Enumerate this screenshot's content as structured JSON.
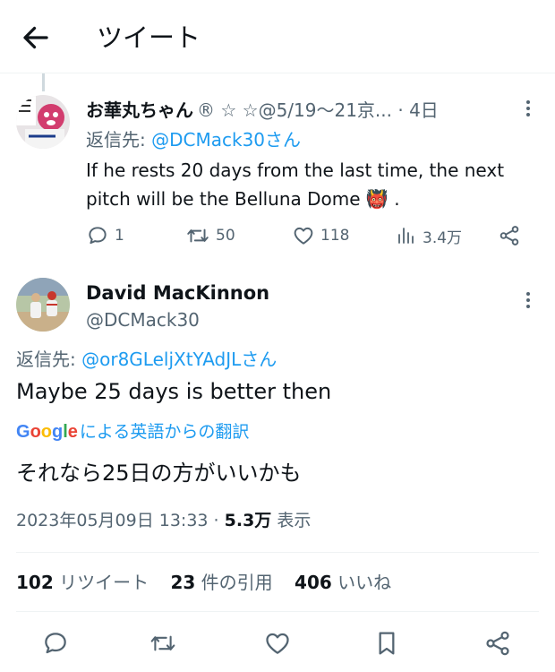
{
  "header": {
    "title": "ツイート"
  },
  "reply_tweet": {
    "display_name": "お華丸ちゃん",
    "name_suffix": "® ☆ ☆@5/19〜21京... · 4日",
    "reply_to_prefix": "返信先: ",
    "reply_to_mention": "@DCMack30さん",
    "text": "If he rests 20 days from the last time, the next pitch will be the Belluna Dome 👹 .",
    "stats": {
      "replies": "1",
      "retweets": "50",
      "likes": "118",
      "views": "3.4万"
    }
  },
  "main_tweet": {
    "display_name": "David MacKinnon",
    "handle": "@DCMack30",
    "reply_to_prefix": "返信先: ",
    "reply_to_mention": "@or8GLeljXtYAdJLさん",
    "text": "Maybe 25 days is better then",
    "translate": {
      "brand": "Google",
      "label": "による英語からの翻訳"
    },
    "translated_text": "それなら25日の方がいいかも",
    "timestamp": "2023年05月09日 13:33 · ",
    "views_count": "5.3万",
    "views_label": " 表示",
    "stats": {
      "retweets_count": "102",
      "retweets_label": " リツイート",
      "quotes_count": "23",
      "quotes_label": " 件の引用",
      "likes_count": "406",
      "likes_label": " いいね"
    }
  },
  "colors": {
    "accent": "#1d9bf0",
    "secondary_text": "#536471",
    "primary_text": "#0f1419",
    "divider": "#eff3f4"
  },
  "icons": [
    "back-arrow-icon",
    "more-vertical-icon",
    "reply-icon",
    "retweet-icon",
    "like-icon",
    "views-icon",
    "share-icon",
    "bookmark-icon",
    "google-logo"
  ]
}
